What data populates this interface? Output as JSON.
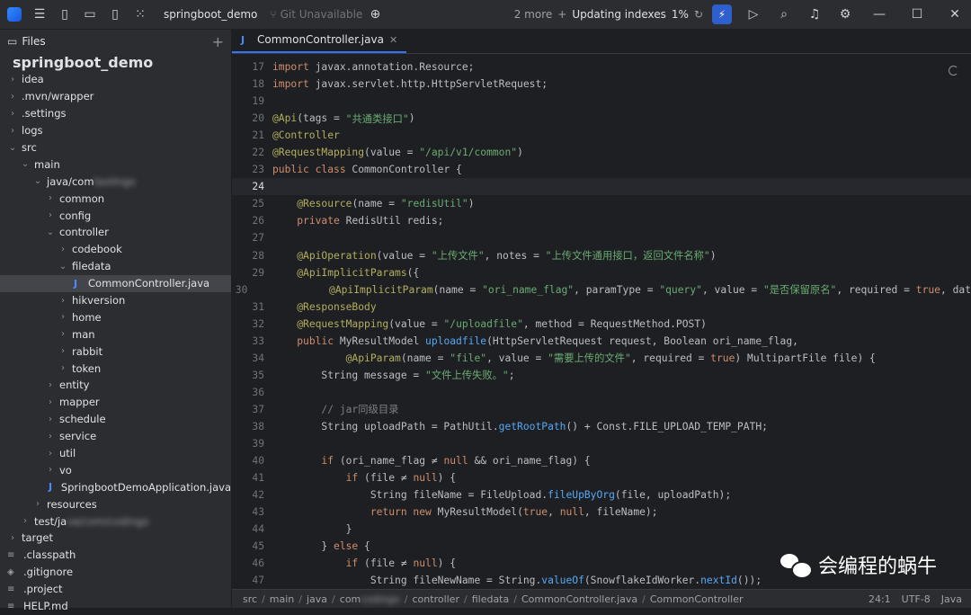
{
  "topbar": {
    "project": "springboot_demo",
    "git": "Git Unavailable",
    "more": "2 more",
    "sep": "+",
    "indexing": "Updating indexes",
    "percent": "1%"
  },
  "sidebar": {
    "title": "Files",
    "root": "springboot_demo",
    "items": [
      {
        "label": "idea",
        "prefix": ".",
        "depth": 0,
        "kind": "folder",
        "chev": "›"
      },
      {
        "label": ".mvn/wrapper",
        "depth": 0,
        "kind": "folder",
        "chev": "›"
      },
      {
        "label": ".settings",
        "depth": 0,
        "kind": "folder",
        "chev": "›"
      },
      {
        "label": "logs",
        "depth": 0,
        "kind": "folder",
        "chev": "›"
      },
      {
        "label": "src",
        "depth": 0,
        "kind": "folder",
        "chev": "⌄"
      },
      {
        "label": "main",
        "depth": 1,
        "kind": "folder",
        "chev": "⌄"
      },
      {
        "label": "java/com",
        "depth": 2,
        "kind": "folder",
        "chev": "⌄",
        "blur": "taxlingo"
      },
      {
        "label": "common",
        "depth": 3,
        "kind": "folder",
        "chev": "›"
      },
      {
        "label": "config",
        "depth": 3,
        "kind": "folder",
        "chev": "›"
      },
      {
        "label": "controller",
        "depth": 3,
        "kind": "folder",
        "chev": "⌄"
      },
      {
        "label": "codebook",
        "depth": 4,
        "kind": "folder",
        "chev": "›"
      },
      {
        "label": "filedata",
        "depth": 4,
        "kind": "folder",
        "chev": "⌄"
      },
      {
        "label": "CommonController.java",
        "depth": 5,
        "kind": "java",
        "selected": true
      },
      {
        "label": "hikversion",
        "depth": 4,
        "kind": "folder",
        "chev": "›"
      },
      {
        "label": "home",
        "depth": 4,
        "kind": "folder",
        "chev": "›"
      },
      {
        "label": "man",
        "depth": 4,
        "kind": "folder",
        "chev": "›"
      },
      {
        "label": "rabbit",
        "depth": 4,
        "kind": "folder",
        "chev": "›"
      },
      {
        "label": "token",
        "depth": 4,
        "kind": "folder",
        "chev": "›"
      },
      {
        "label": "entity",
        "depth": 3,
        "kind": "folder",
        "chev": "›"
      },
      {
        "label": "mapper",
        "depth": 3,
        "kind": "folder",
        "chev": "›"
      },
      {
        "label": "schedule",
        "depth": 3,
        "kind": "folder",
        "chev": "›"
      },
      {
        "label": "service",
        "depth": 3,
        "kind": "folder",
        "chev": "›"
      },
      {
        "label": "util",
        "depth": 3,
        "kind": "folder",
        "chev": "›"
      },
      {
        "label": "vo",
        "depth": 3,
        "kind": "folder",
        "chev": "›"
      },
      {
        "label": "SpringbootDemoApplication.java",
        "depth": 3,
        "kind": "java"
      },
      {
        "label": "resources",
        "depth": 2,
        "kind": "folder",
        "chev": "›"
      },
      {
        "label": "test/ja",
        "depth": 1,
        "kind": "folder",
        "chev": "›",
        "blur": "va/com/codingo"
      },
      {
        "label": "target",
        "depth": 0,
        "kind": "folder",
        "chev": "›"
      },
      {
        "label": ".classpath",
        "depth": 0,
        "kind": "file"
      },
      {
        "label": ".gitignore",
        "depth": 0,
        "kind": "git"
      },
      {
        "label": ".project",
        "depth": 0,
        "kind": "file"
      },
      {
        "label": "HELP.md",
        "depth": 0,
        "kind": "file"
      }
    ]
  },
  "editor": {
    "tab": "CommonController.java",
    "current_line": 24,
    "lines": [
      {
        "n": 17,
        "t": [
          [
            "kw",
            "import "
          ],
          [
            "",
            "javax.annotation.Resource;"
          ]
        ]
      },
      {
        "n": 18,
        "t": [
          [
            "kw",
            "import "
          ],
          [
            "",
            "javax.servlet.http.HttpServletRequest;"
          ]
        ]
      },
      {
        "n": 19,
        "t": []
      },
      {
        "n": 20,
        "t": [
          [
            "ann",
            "@Api"
          ],
          [
            "",
            "(tags = "
          ],
          [
            "str",
            "\"共通类接口\""
          ],
          [
            "",
            ")"
          ]
        ]
      },
      {
        "n": 21,
        "t": [
          [
            "ann",
            "@Controller"
          ]
        ]
      },
      {
        "n": 22,
        "t": [
          [
            "ann",
            "@RequestMapping"
          ],
          [
            "",
            "(value = "
          ],
          [
            "str",
            "\"/api/v1/common\""
          ],
          [
            "",
            ")"
          ]
        ]
      },
      {
        "n": 23,
        "t": [
          [
            "kw",
            "public class "
          ],
          [
            "",
            "CommonController {"
          ]
        ]
      },
      {
        "n": 24,
        "t": []
      },
      {
        "n": 25,
        "t": [
          [
            "",
            "    "
          ],
          [
            "ann",
            "@Resource"
          ],
          [
            "",
            "(name = "
          ],
          [
            "str",
            "\"redisUtil\""
          ],
          [
            "",
            ")"
          ]
        ]
      },
      {
        "n": 26,
        "t": [
          [
            "",
            "    "
          ],
          [
            "kw",
            "private "
          ],
          [
            "",
            "RedisUtil redis;"
          ]
        ]
      },
      {
        "n": 27,
        "t": []
      },
      {
        "n": 28,
        "t": [
          [
            "",
            "    "
          ],
          [
            "ann",
            "@ApiOperation"
          ],
          [
            "",
            "(value = "
          ],
          [
            "str",
            "\"上传文件\""
          ],
          [
            "",
            ", notes = "
          ],
          [
            "str",
            "\"上传文件通用接口，返回文件名称\""
          ],
          [
            "",
            ")"
          ]
        ]
      },
      {
        "n": 29,
        "t": [
          [
            "",
            "    "
          ],
          [
            "ann",
            "@ApiImplicitParams"
          ],
          [
            "",
            "({"
          ]
        ]
      },
      {
        "n": 30,
        "t": [
          [
            "",
            "            "
          ],
          [
            "ann",
            "@ApiImplicitParam"
          ],
          [
            "",
            "(name = "
          ],
          [
            "str",
            "\"ori_name_flag\""
          ],
          [
            "",
            ", paramType = "
          ],
          [
            "str",
            "\"query\""
          ],
          [
            "",
            ", value = "
          ],
          [
            "str",
            "\"是否保留原名\""
          ],
          [
            "",
            ", required = "
          ],
          [
            "kw",
            "true"
          ],
          [
            "",
            ", dat"
          ]
        ]
      },
      {
        "n": 31,
        "t": [
          [
            "",
            "    "
          ],
          [
            "ann",
            "@ResponseBody"
          ]
        ]
      },
      {
        "n": 32,
        "t": [
          [
            "",
            "    "
          ],
          [
            "ann",
            "@RequestMapping"
          ],
          [
            "",
            "(value = "
          ],
          [
            "str",
            "\"/uploadfile\""
          ],
          [
            "",
            ", method = RequestMethod.POST)"
          ]
        ]
      },
      {
        "n": 33,
        "t": [
          [
            "",
            "    "
          ],
          [
            "kw",
            "public "
          ],
          [
            "",
            "MyResultModel "
          ],
          [
            "fn",
            "uploadfile"
          ],
          [
            "",
            "(HttpServletRequest request, Boolean ori_name_flag,"
          ]
        ]
      },
      {
        "n": 34,
        "t": [
          [
            "",
            "            "
          ],
          [
            "ann",
            "@ApiParam"
          ],
          [
            "",
            "(name = "
          ],
          [
            "str",
            "\"file\""
          ],
          [
            "",
            ", value = "
          ],
          [
            "str",
            "\"需要上传的文件\""
          ],
          [
            "",
            ", required = "
          ],
          [
            "kw",
            "true"
          ],
          [
            "",
            ") MultipartFile file) {"
          ]
        ]
      },
      {
        "n": 35,
        "t": [
          [
            "",
            "        String message = "
          ],
          [
            "str",
            "\"文件上传失败。\""
          ],
          [
            "",
            ";"
          ]
        ]
      },
      {
        "n": 36,
        "t": []
      },
      {
        "n": 37,
        "t": [
          [
            "",
            "        "
          ],
          [
            "cmt",
            "// jar同级目录"
          ]
        ]
      },
      {
        "n": 38,
        "t": [
          [
            "",
            "        String uploadPath = PathUtil."
          ],
          [
            "fn",
            "getRootPath"
          ],
          [
            "",
            "() + Const.FILE_UPLOAD_TEMP_PATH;"
          ]
        ]
      },
      {
        "n": 39,
        "t": []
      },
      {
        "n": 40,
        "t": [
          [
            "",
            "        "
          ],
          [
            "kw",
            "if "
          ],
          [
            "",
            "(ori_name_flag ≠ "
          ],
          [
            "kw",
            "null "
          ],
          [
            "",
            "&& ori_name_flag) {"
          ]
        ]
      },
      {
        "n": 41,
        "t": [
          [
            "",
            "            "
          ],
          [
            "kw",
            "if "
          ],
          [
            "",
            "(file ≠ "
          ],
          [
            "kw",
            "null"
          ],
          [
            "",
            ") {"
          ]
        ]
      },
      {
        "n": 42,
        "t": [
          [
            "",
            "                String fileName = FileUpload."
          ],
          [
            "fn",
            "fileUpByOrg"
          ],
          [
            "",
            "(file, uploadPath);"
          ]
        ]
      },
      {
        "n": 43,
        "t": [
          [
            "",
            "                "
          ],
          [
            "kw",
            "return new "
          ],
          [
            "",
            "MyResultModel("
          ],
          [
            "kw",
            "true"
          ],
          [
            "",
            ", "
          ],
          [
            "kw",
            "null"
          ],
          [
            "",
            ", fileName);"
          ]
        ]
      },
      {
        "n": 44,
        "t": [
          [
            "",
            "            }"
          ]
        ]
      },
      {
        "n": 45,
        "t": [
          [
            "",
            "        } "
          ],
          [
            "kw",
            "else "
          ],
          [
            "",
            "{"
          ]
        ]
      },
      {
        "n": 46,
        "t": [
          [
            "",
            "            "
          ],
          [
            "kw",
            "if "
          ],
          [
            "",
            "(file ≠ "
          ],
          [
            "kw",
            "null"
          ],
          [
            "",
            ") {"
          ]
        ]
      },
      {
        "n": 47,
        "t": [
          [
            "",
            "                String fileNewName = String."
          ],
          [
            "fn",
            "valueOf"
          ],
          [
            "",
            "(SnowflakeIdWorker."
          ],
          [
            "fn",
            "nextId"
          ],
          [
            "",
            "());"
          ]
        ]
      }
    ]
  },
  "breadcrumb": {
    "items": [
      "src",
      "main",
      "java",
      "com",
      "controller",
      "filedata",
      "CommonController.java",
      "CommonController"
    ],
    "blur_after_com": "codingo",
    "position": "24:1",
    "encoding": "UTF-8",
    "language": "Java"
  },
  "watermark": {
    "text": "会编程的蜗牛"
  }
}
